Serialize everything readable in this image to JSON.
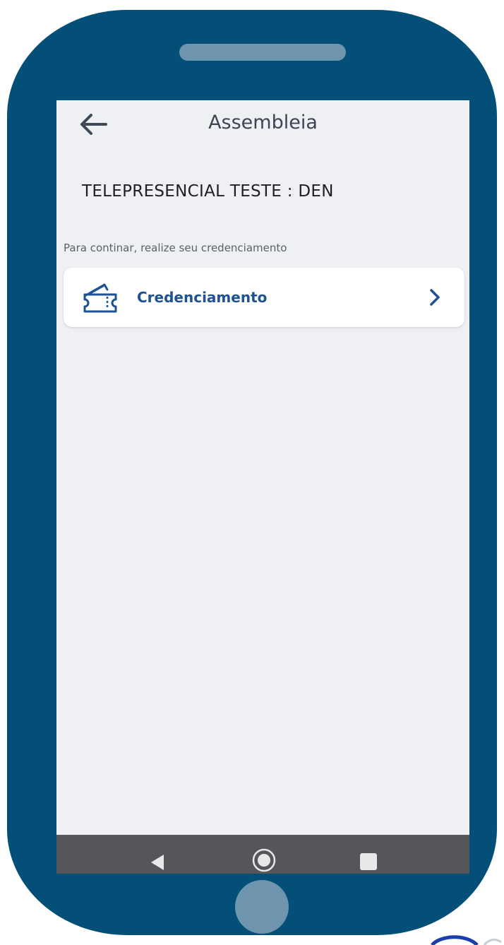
{
  "appbar": {
    "title": "Assembleia",
    "back_icon": "arrow-left-icon"
  },
  "page": {
    "title": "TELEPRESENCIAL TESTE : DEN",
    "instruction": "Para continar, realize seu credenciamento"
  },
  "credential_card": {
    "label": "Credenciamento",
    "icon": "ticket-icon",
    "chevron": "chevron-right-icon"
  },
  "android_nav": {
    "back": "nav-back-triangle-icon",
    "home": "nav-home-circle-icon",
    "recent": "nav-recent-square-icon"
  },
  "colors": {
    "device_frame": "#034f78",
    "device_accent": "#6f94ad",
    "screen_background": "#eef0f4",
    "card_background": "#ffffff",
    "accent_blue": "#1d5294",
    "navbar": "#545659"
  }
}
